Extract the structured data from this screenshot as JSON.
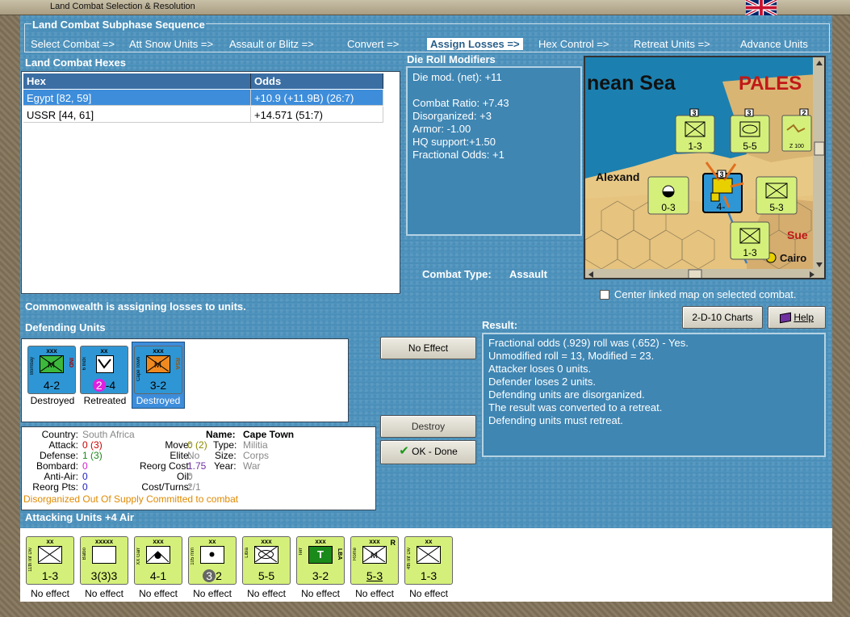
{
  "window": {
    "title": "Land Combat Selection & Resolution"
  },
  "subphase": {
    "title": "Land Combat Subphase Sequence",
    "steps": [
      "Select Combat =>",
      "Att Snow Units =>",
      "Assault or Blitz =>",
      "Convert =>",
      "Assign Losses =>",
      "Hex Control =>",
      "Retreat Units =>",
      "Advance Units"
    ],
    "active_index": 4
  },
  "hexes": {
    "title": "Land Combat Hexes",
    "columns": [
      "Hex",
      "Odds"
    ],
    "rows": [
      {
        "hex": "Egypt [82, 59]",
        "odds": "+10.9 (+11.9B) (26:7)"
      },
      {
        "hex": "USSR [44, 61]",
        "odds": "+14.571 (51:7)"
      }
    ]
  },
  "die_roll": {
    "title": "Die Roll Modifiers",
    "lines": [
      "Die mod. (net): +11",
      "",
      "Combat Ratio: +7.43",
      "Disorganized: +3",
      "Armor: -1.00",
      "HQ support:+1.50",
      "Fractional Odds: +1"
    ]
  },
  "combat_type": {
    "label": "Combat Type:",
    "value": "Assault"
  },
  "map": {
    "labels": {
      "sea": "nean Sea",
      "pales": "PALES",
      "alex": "Alexand",
      "suez": "Sue",
      "cairo": "Cairo"
    },
    "units": [
      {
        "top": "xx",
        "side": "11th Inf Div",
        "vals": "1-3",
        "color": "lime",
        "symbol": "inf"
      },
      {
        "top": "xxx",
        "side": "Pilos",
        "vals": "5-5",
        "color": "lime",
        "symbol": "armor"
      },
      {
        "top": "",
        "side": "Supply",
        "vals": "0-3",
        "color": "lime",
        "symbol": "supply"
      },
      {
        "top": "xxx",
        "side": "Rome",
        "vals": "5-3",
        "color": "lime",
        "symbol": "mech"
      },
      {
        "top": "xx",
        "side": "4th Inf Div",
        "vals": "1-3",
        "color": "lime",
        "symbol": "inf"
      },
      {
        "top": "",
        "side": "Bombay",
        "vals": "4-",
        "color": "blue",
        "symbol": "mech"
      }
    ],
    "stack_counts": [
      "3",
      "3",
      "2",
      "3"
    ],
    "mini_text": "Z 100"
  },
  "center_map": {
    "label": "Center linked map on selected combat.",
    "checked": false
  },
  "message": "Commonwealth is assigning losses to units.",
  "defending": {
    "title": "Defending Units",
    "units": [
      {
        "size": "xxx",
        "side": "Bombay",
        "side_r": "IND",
        "vals": "4-2",
        "status": "Destroyed",
        "symbol": "mech-green",
        "selected": false
      },
      {
        "size": "xx",
        "side": "6 Indx",
        "side_r": "",
        "vals_pre": "2",
        "vals": "-4",
        "status": "Retreated",
        "symbol": "air",
        "selected": false
      },
      {
        "size": "xxx",
        "side": "Cape Town",
        "side_r": "RSA",
        "vals": "3-2",
        "status": "Destroyed",
        "symbol": "mech-orange",
        "selected": true
      }
    ]
  },
  "details": {
    "country_label": "Country:",
    "country": "South Africa",
    "name_label": "Name:",
    "name": "Cape Town",
    "attack_label": "Attack:",
    "attack": "0",
    "attack_paren": "(3)",
    "move_label": "Move:",
    "move": "0",
    "move_paren": "(2)",
    "type_label": "Type:",
    "type": "Militia",
    "defense_label": "Defense:",
    "defense": "1",
    "defense_paren": "(3)",
    "elite_label": "Elite:",
    "elite": "No",
    "size_label": "Size:",
    "size": "Corps",
    "bombard_label": "Bombard:",
    "bombard": "0",
    "reorg_cost_label": "Reorg Cost:",
    "reorg_cost": "1.75",
    "year_label": "Year:",
    "year": "War",
    "antiair_label": "Anti-Air:",
    "antiair": "0",
    "oil_label": "Oil:",
    "oil": "0",
    "reorg_pts_label": "Reorg Pts:",
    "reorg_pts": "0",
    "cost_turns_label": "Cost/Turns:",
    "cost_turns": "2/1",
    "status_line": "Disorganized Out Of Supply Committed to combat"
  },
  "buttons": {
    "no_effect": "No Effect",
    "destroy": "Destroy",
    "ok_done": "OK - Done",
    "charts": "2-D-10 Charts",
    "help": "Help"
  },
  "result": {
    "title": "Result:",
    "lines": [
      "Fractional odds (.929) roll was (.652)  - Yes.",
      "Unmodified roll = 13, Modified = 23.",
      "Attacker loses 0 units.",
      "Defender loses 2 units.",
      "Defending units are disorganized.",
      "The result was converted to a retreat.",
      "Defending units must retreat."
    ]
  },
  "attacking": {
    "title": "Attacking Units +4 Air",
    "units": [
      {
        "size": "xx",
        "side": "11th Inf Div",
        "vals": "1-3",
        "status": "No effect",
        "symbol": "inf"
      },
      {
        "size": "xxxxx",
        "side": "Balbo",
        "vals": "3(3)3",
        "status": "No effect",
        "symbol": "blank"
      },
      {
        "size": "xxx",
        "side": "XX Garr",
        "vals": "4-1",
        "status": "No effect",
        "symbol": "garrison"
      },
      {
        "size": "xx",
        "side": "105 mm",
        "vals_pre": "3",
        "vals": "2",
        "status": "No effect",
        "symbol": "artillery"
      },
      {
        "size": "xxx",
        "side": "Libia",
        "vals": "5-5",
        "status": "No effect",
        "symbol": "armor"
      },
      {
        "size": "xxx",
        "side": "Terr",
        "side_r": "LBA",
        "vals": "3-2",
        "status": "No effect",
        "symbol": "territorial"
      },
      {
        "size": "xxx",
        "side": "Rome",
        "vals": "5-3",
        "status": "No effect",
        "symbol": "mech",
        "corner": "R"
      },
      {
        "size": "xx",
        "side": "4th Inf Div",
        "vals": "1-3",
        "status": "No effect",
        "symbol": "inf"
      }
    ]
  },
  "colors": {
    "panel_blue": "#4b90ba",
    "selected_row": "#3d8ddb",
    "unit_blue": "#2e96d4",
    "unit_lime": "#d5f07a"
  }
}
